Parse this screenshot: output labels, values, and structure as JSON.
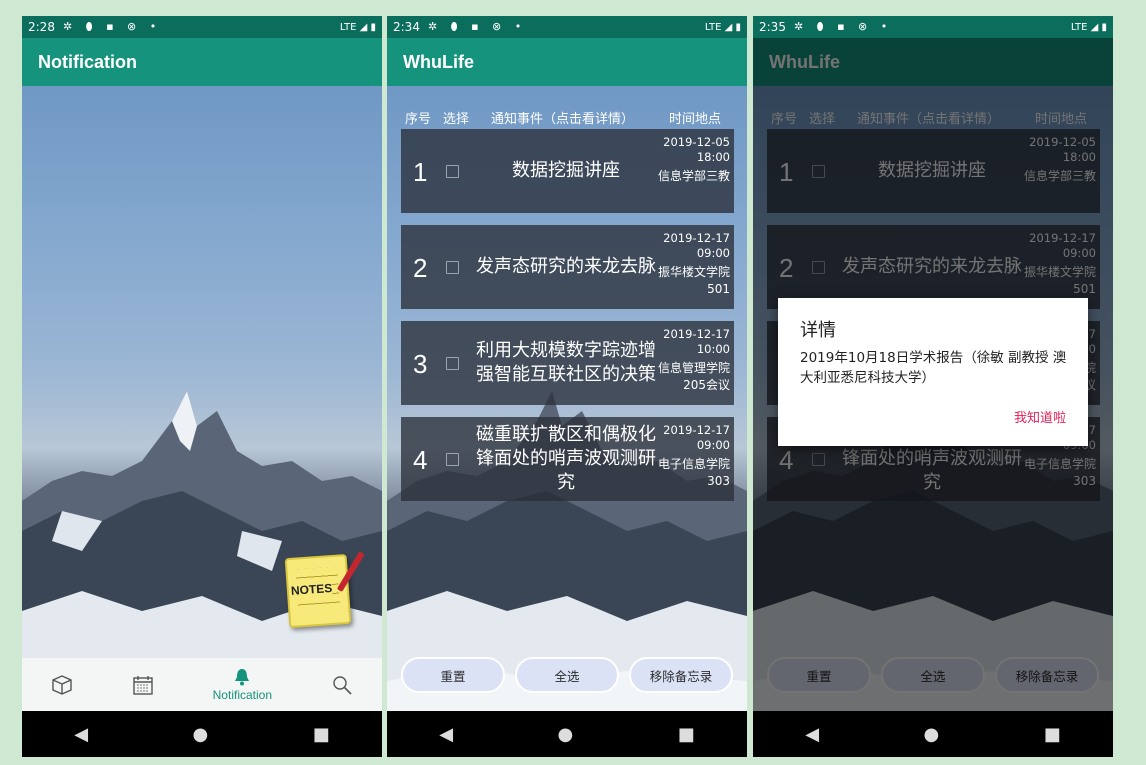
{
  "screens": [
    {
      "status": {
        "time": "2:28",
        "icons": "✲ ⬮ ▪ ⊗ •",
        "network": "LTE ◢ ▮"
      },
      "appbar_title": "Notification",
      "notes_label": "NOTES",
      "bottom_nav": [
        {
          "icon": "cube-icon",
          "label": ""
        },
        {
          "icon": "calendar-icon",
          "label": ""
        },
        {
          "icon": "bell-icon",
          "label": "Notification",
          "active": true
        },
        {
          "icon": "search-icon",
          "label": ""
        }
      ]
    },
    {
      "status": {
        "time": "2:34",
        "icons": "✲ ⬮ ▪ ⊗ •",
        "network": "LTE ◢ ▮"
      },
      "appbar_title": "WhuLife",
      "columns": {
        "index": "序号",
        "select": "选择",
        "event": "通知事件（点击看详情）",
        "time_place": "时间地点"
      },
      "rows": [
        {
          "num": "1",
          "title": "数据挖掘讲座",
          "date": "2019-12-05",
          "clock": "18:00",
          "place": "信息学部三教"
        },
        {
          "num": "2",
          "title": "发声态研究的来龙去脉",
          "date": "2019-12-17",
          "clock": "09:00",
          "place": "振华楼文学院501"
        },
        {
          "num": "3",
          "title": "利用大规模数字踪迹增强智能互联社区的决策",
          "date": "2019-12-17",
          "clock": "10:00",
          "place": "信息管理学院205会议"
        },
        {
          "num": "4",
          "title": "磁重联扩散区和偶极化锋面处的哨声波观测研究",
          "date": "2019-12-17",
          "clock": "09:00",
          "place": "电子信息学院303"
        }
      ],
      "buttons": {
        "reset": "重置",
        "select_all": "全选",
        "remove": "移除备忘录"
      }
    },
    {
      "status": {
        "time": "2:35",
        "icons": "✲ ⬮ ▪ ⊗ •",
        "network": "LTE ◢ ▮"
      },
      "dialog": {
        "title": "详情",
        "message": "2019年10月18日学术报告（徐敏 副教授 澳大利亚悉尼科技大学）",
        "button": "我知道啦"
      }
    }
  ],
  "system_nav": {
    "back": "◀",
    "home": "●",
    "recents": "■"
  }
}
